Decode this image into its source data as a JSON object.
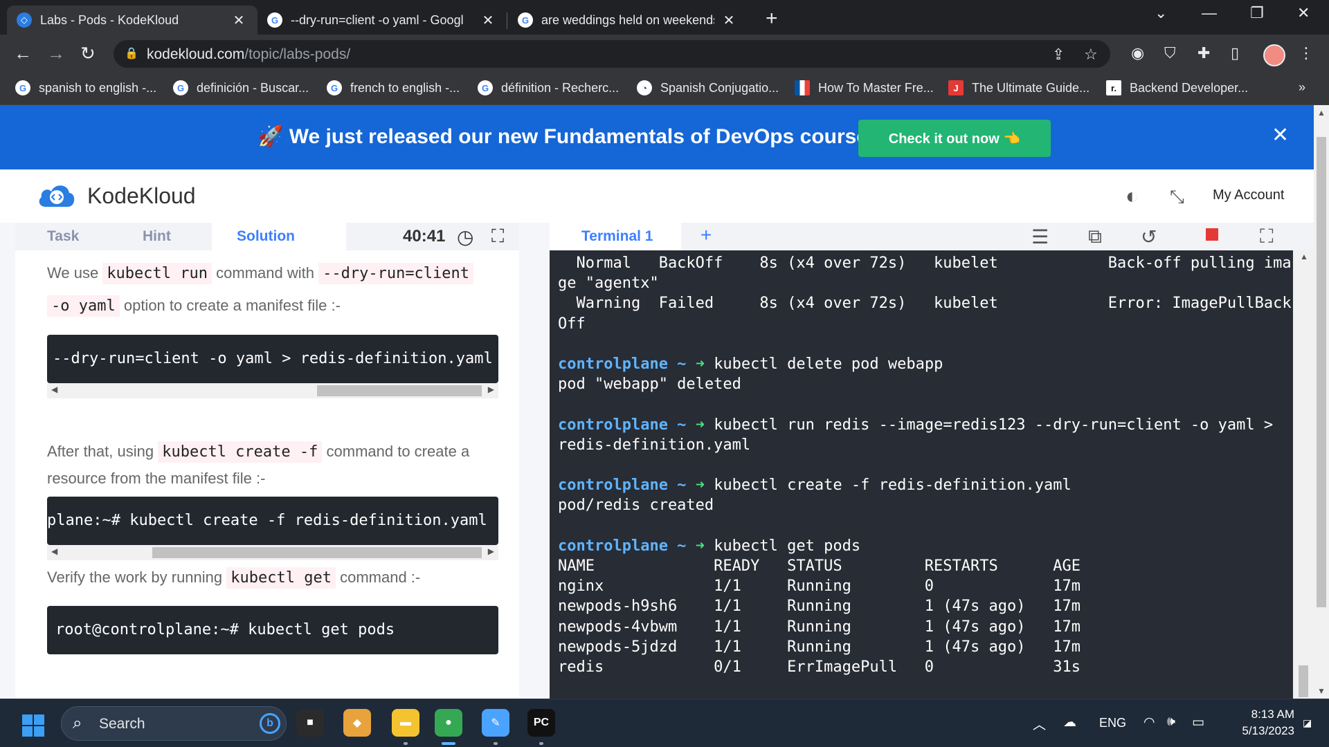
{
  "browser": {
    "tabs": [
      {
        "title": "Labs - Pods - KodeKloud",
        "favicon": "kodekloud-icon",
        "active": true
      },
      {
        "title": "--dry-run=client -o yaml - Googl",
        "favicon": "google-icon",
        "active": false
      },
      {
        "title": "are weddings held on weekends",
        "favicon": "google-icon",
        "active": false
      }
    ],
    "new_tab_glyph": "+",
    "url_domain": "kodekloud.com",
    "url_path": "/topic/labs-pods/",
    "bookmarks": [
      {
        "label": "spanish to english -...",
        "icon": "google-icon"
      },
      {
        "label": "definición - Buscar...",
        "icon": "google-icon"
      },
      {
        "label": "french to english -...",
        "icon": "google-icon"
      },
      {
        "label": "définition - Recherc...",
        "icon": "google-icon"
      },
      {
        "label": "Spanish Conjugatio...",
        "icon": "spanishdict-icon"
      },
      {
        "label": "How To Master Fre...",
        "icon": "french-flag-icon"
      },
      {
        "label": "The Ultimate Guide...",
        "icon": "j-icon"
      },
      {
        "label": "Backend Developer...",
        "icon": "r-icon"
      }
    ],
    "bookmarks_more": "»"
  },
  "banner": {
    "text": "🚀 We just released our new Fundamentals of DevOps course",
    "button": "Check it out now 👈",
    "close": "✕"
  },
  "header": {
    "brand": "KodeKloud",
    "account": "My Account"
  },
  "left": {
    "tabs": [
      "Task",
      "Hint",
      "Solution"
    ],
    "active_tab": "Solution",
    "timer": "40:41",
    "p1_a": "We use",
    "p1_code1": "kubectl run",
    "p1_b": "command with",
    "p1_code2": "--dry-run=client",
    "p1_code3": "-o yaml",
    "p1_c": "option to create a manifest file :-",
    "code1": "--dry-run=client -o yaml > redis-definition.yaml",
    "p2_a": "After that, using",
    "p2_code1": "kubectl create -f",
    "p2_b": "command to create a",
    "p2_c": "resource from the manifest file :-",
    "code2": "plane:~# kubectl create -f redis-definition.yaml",
    "p3_a": "Verify the work by running",
    "p3_code1": "kubectl get",
    "p3_b": "command :-",
    "code3": "root@controlplane:~# kubectl get pods"
  },
  "terminal": {
    "tab_label": "Terminal 1",
    "add_glyph": "+",
    "lines": [
      {
        "text": "  Normal   BackOff    8s (x4 over 72s)   kubelet            Back-off pulling ima"
      },
      {
        "text": "ge \"agentx\""
      },
      {
        "text": "  Warning  Failed     8s (x4 over 72s)   kubelet            Error: ImagePullBack"
      },
      {
        "text": "Off"
      },
      {
        "text": ""
      },
      {
        "prompt": "controlplane ~",
        "arrow": "➜",
        "cmd": "kubectl delete pod webapp"
      },
      {
        "text": "pod \"webapp\" deleted"
      },
      {
        "text": ""
      },
      {
        "prompt": "controlplane ~",
        "arrow": "➜",
        "cmd": "kubectl run redis --image=redis123 --dry-run=client -o yaml >"
      },
      {
        "text": "redis-definition.yaml"
      },
      {
        "text": ""
      },
      {
        "prompt": "controlplane ~",
        "arrow": "➜",
        "cmd": "kubectl create -f redis-definition.yaml"
      },
      {
        "text": "pod/redis created"
      },
      {
        "text": ""
      },
      {
        "prompt": "controlplane ~",
        "arrow": "➜",
        "cmd": "kubectl get pods"
      },
      {
        "text": "NAME             READY   STATUS         RESTARTS      AGE"
      },
      {
        "text": "nginx            1/1     Running        0             17m"
      },
      {
        "text": "newpods-h9sh6    1/1     Running        1 (47s ago)   17m"
      },
      {
        "text": "newpods-4vbwm    1/1     Running        1 (47s ago)   17m"
      },
      {
        "text": "newpods-5jdzd    1/1     Running        1 (47s ago)   17m"
      },
      {
        "text": "redis            0/1     ErrImagePull   0             31s"
      }
    ]
  },
  "taskbar": {
    "search_placeholder": "Search",
    "apps": [
      {
        "name": "task-view-app",
        "label": "■",
        "color": "#2b2b2b"
      },
      {
        "name": "sticky-app",
        "label": "◆",
        "color": "#e8a33d"
      },
      {
        "name": "file-explorer-app",
        "label": "▬",
        "color": "#f4c430"
      },
      {
        "name": "chrome-app",
        "label": "●",
        "color": "#34a853"
      },
      {
        "name": "paint-app",
        "label": "✎",
        "color": "#4aa3ff"
      },
      {
        "name": "pycharm-app",
        "label": "PC",
        "color": "#111111"
      }
    ],
    "lang": "ENG",
    "time": "8:13 AM",
    "date": "5/13/2023"
  }
}
